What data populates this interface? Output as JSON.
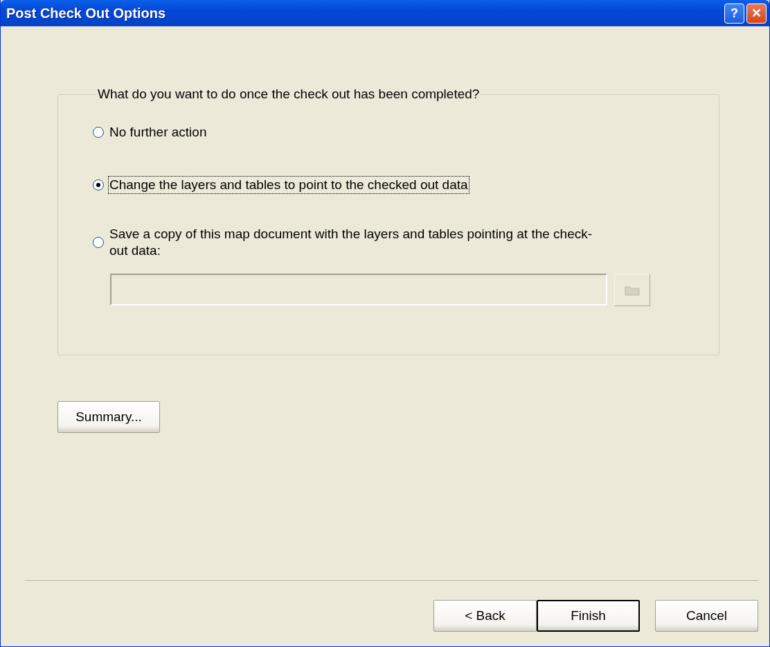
{
  "window": {
    "title": "Post Check Out Options"
  },
  "title_buttons": [
    {
      "kind": "help",
      "label": "?"
    },
    {
      "kind": "close",
      "label": "✕"
    }
  ],
  "group": {
    "legend": "What do you want to do once the check out has been completed?",
    "options": [
      {
        "label": "No further action",
        "selected": false,
        "focused": false
      },
      {
        "label": "Change the layers and tables to point to the checked out data",
        "selected": true,
        "focused": true
      },
      {
        "label": "Save a copy of this map document with the layers and tables pointing at the check-out data:",
        "selected": false,
        "focused": false
      }
    ],
    "path_field": {
      "disabled": true
    },
    "browse_button": {
      "disabled": true
    }
  },
  "summary_button": "Summary...",
  "buttons": [
    {
      "label": "< Back",
      "default": false
    },
    {
      "label": "Finish",
      "default": true
    },
    {
      "label": "Cancel",
      "default": false
    }
  ]
}
